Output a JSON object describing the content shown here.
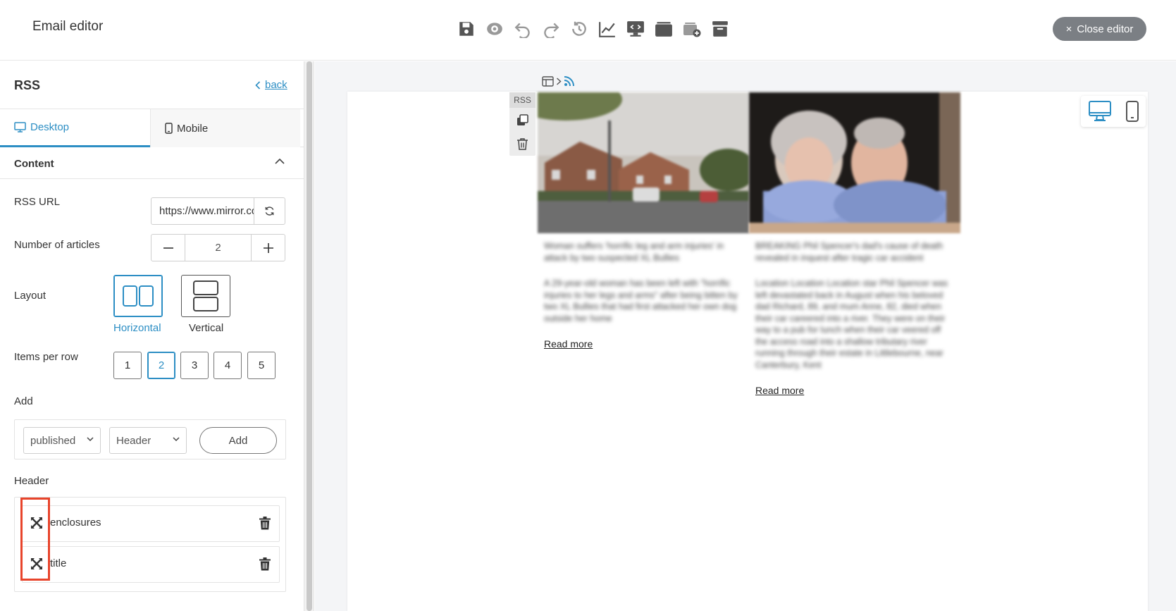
{
  "app": {
    "title": "Email editor",
    "close_label": "Close editor",
    "close_icon": "×"
  },
  "toolbar": {
    "icons": [
      "save-icon",
      "preview-icon",
      "undo-icon",
      "redo-icon",
      "history-icon",
      "analytics-icon",
      "desktop-preview-icon",
      "template-box-icon",
      "add-template-icon",
      "store-icon"
    ]
  },
  "panel": {
    "title": "RSS",
    "back_label": "back",
    "tabs": [
      {
        "label": "Desktop"
      },
      {
        "label": "Mobile"
      }
    ],
    "section_label": "Content",
    "rss_url_label": "RSS URL",
    "rss_url_value": "https://www.mirror.co.uk/news/?service=rss",
    "articles_label": "Number of articles",
    "articles_value": "2",
    "layout_label": "Layout",
    "layout_options": [
      {
        "label": "Horizontal",
        "selected": true
      },
      {
        "label": "Vertical",
        "selected": false
      }
    ],
    "items_per_row_label": "Items per row",
    "items_per_row_options": [
      "1",
      "2",
      "3",
      "4",
      "5"
    ],
    "items_per_row_selected": "2",
    "add_label": "Add",
    "add_select_1": "published",
    "add_select_2": "Header",
    "add_button": "Add",
    "header_label": "Header",
    "header_fields": [
      {
        "name": "enclosures"
      },
      {
        "name": "title"
      }
    ]
  },
  "canvas": {
    "block_tag": "RSS",
    "articles": [
      {
        "title": "Woman suffers 'horrific leg and arm injuries' in attack by two suspected XL Bullies",
        "description": "A 29-year-old woman has been left with \"horrific injuries to her legs and arms\" after being bitten by two XL Bullies that had first attacked her own dog outside her home",
        "read_more": "Read more"
      },
      {
        "title": "BREAKING Phil Spencer's dad's cause of death revealed in inquest after tragic car accident",
        "description": "Location Location Location star Phil Spencer was left devastated back in August when his beloved dad Richard, 89, and mum Anne, 82, died when their car careered into a river. They were on their way to a pub for lunch when their car veered off the access road into a shallow tributary river running through their estate in Littlebourne, near Canterbury, Kent",
        "read_more": "Read more"
      }
    ]
  },
  "colors": {
    "accent": "#2c8ec4",
    "close_bg": "#7b7f84",
    "highlight": "#e8442b"
  }
}
